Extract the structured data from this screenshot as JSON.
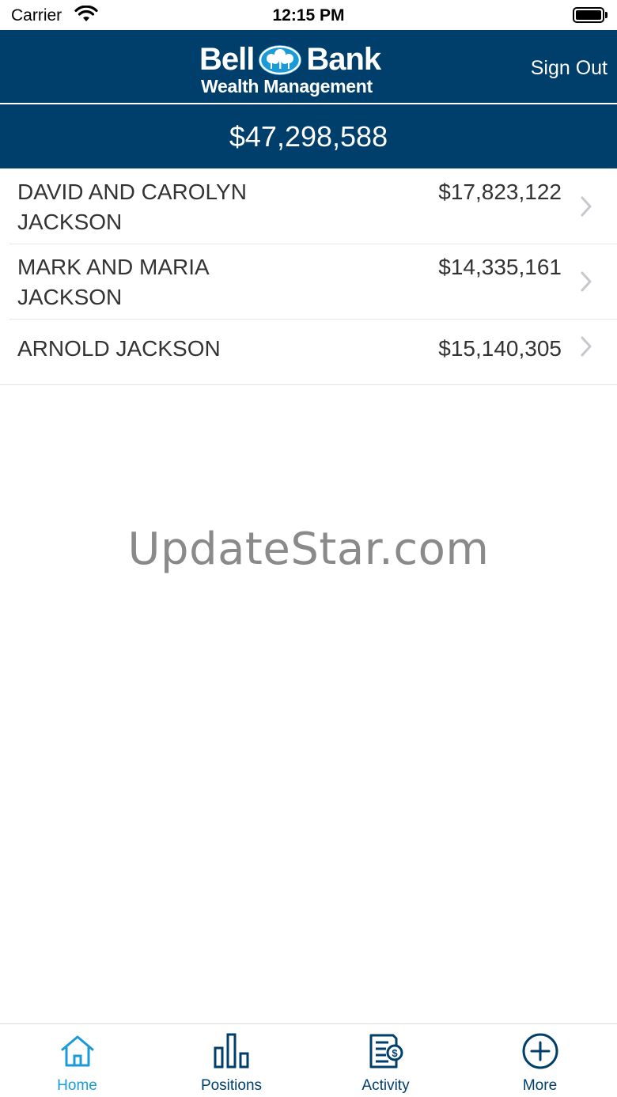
{
  "status_bar": {
    "carrier": "Carrier",
    "time": "12:15 PM",
    "wifi_icon": "wifi-icon",
    "battery_icon": "battery-icon"
  },
  "header": {
    "logo_word_left": "Bell",
    "logo_word_right": "Bank",
    "logo_subtitle": "Wealth Management",
    "sign_out_label": "Sign Out"
  },
  "total": {
    "amount": "$47,298,588"
  },
  "accounts": [
    {
      "name": "DAVID AND CAROLYN JACKSON",
      "amount": "$17,823,122"
    },
    {
      "name": "MARK AND MARIA JACKSON",
      "amount": "$14,335,161"
    },
    {
      "name": "ARNOLD JACKSON",
      "amount": "$15,140,305"
    }
  ],
  "watermark": "UpdateStar.com",
  "tabs": [
    {
      "label": "Home",
      "icon": "home-icon",
      "active": true
    },
    {
      "label": "Positions",
      "icon": "bar-chart-icon",
      "active": false
    },
    {
      "label": "Activity",
      "icon": "document-dollar-icon",
      "active": false
    },
    {
      "label": "More",
      "icon": "plus-circle-icon",
      "active": false
    }
  ],
  "colors": {
    "brand_navy": "#003e6b",
    "tab_active": "#1a9bd7",
    "tab_inactive": "#003e6b",
    "text": "#333333",
    "chevron": "#c7c7cc"
  }
}
